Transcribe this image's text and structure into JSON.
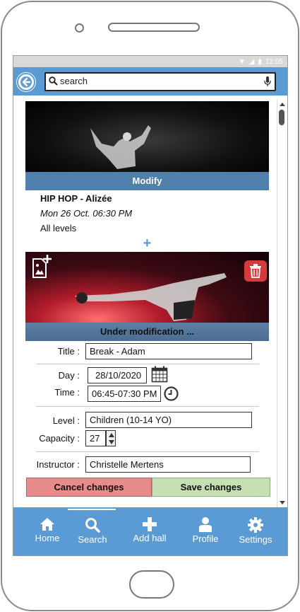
{
  "status": {
    "time": "12:05"
  },
  "search": {
    "placeholder": "search"
  },
  "events": [
    {
      "action_label": "Modify",
      "title": "HIP HOP - Alizée",
      "date": "Mon 26 Oct. 06:30 PM",
      "level": "All levels",
      "add_symbol": "+"
    }
  ],
  "edit": {
    "status_label": "Under modification ...",
    "title_label": "Title :",
    "title_value": "Break - Adam",
    "day_label": "Day :",
    "day_value": "28/10/2020",
    "time_label": "Time :",
    "time_value": "06:45-07:30 PM",
    "level_label": "Level :",
    "level_value": "Children (10-14 YO)",
    "capacity_label": "Capacity :",
    "capacity_value": "27",
    "instructor_label": "Instructor :",
    "instructor_value": "Christelle Mertens",
    "cancel_label": "Cancel changes",
    "save_label": "Save changes"
  },
  "nav": {
    "items": [
      {
        "label": "Home",
        "icon": "home-icon"
      },
      {
        "label": "Search",
        "icon": "search-icon"
      },
      {
        "label": "Add hall",
        "icon": "plus-icon"
      },
      {
        "label": "Profile",
        "icon": "user-icon"
      },
      {
        "label": "Settings",
        "icon": "gear-icon"
      }
    ],
    "active": "Search"
  },
  "colors": {
    "primary": "#5b9bd5",
    "cancel": "#e88b8b",
    "save": "#c6e0b4",
    "delete": "#d63b3b"
  }
}
